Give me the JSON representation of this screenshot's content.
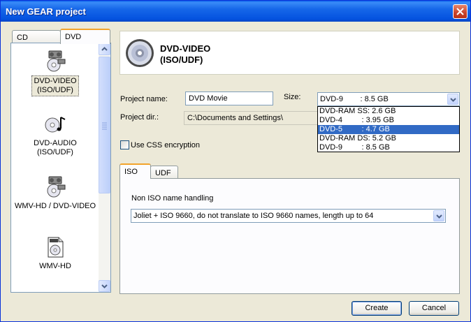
{
  "window": {
    "title": "New GEAR project"
  },
  "left_panel": {
    "tabs": [
      {
        "label": "CD"
      },
      {
        "label": "DVD"
      }
    ],
    "active_tab": "DVD",
    "items": [
      {
        "label": "DVD-VIDEO\n(ISO/UDF)",
        "icon": "dvd-video-icon",
        "selected": true
      },
      {
        "label": "DVD-AUDIO\n(ISO/UDF)",
        "icon": "dvd-audio-icon",
        "selected": false
      },
      {
        "label": "WMV-HD / DVD-VIDEO",
        "icon": "wmv-hd-dvd-video-icon",
        "selected": false
      },
      {
        "label": "WMV-HD",
        "icon": "wmv-hd-icon",
        "selected": false
      }
    ]
  },
  "header": {
    "title": "DVD-VIDEO\n(ISO/UDF)",
    "icon": "disc-icon"
  },
  "form": {
    "project_name_label": "Project name:",
    "project_name_value": "DVD Movie",
    "size_label": "Size:",
    "size_value": "DVD-9        : 8.5 GB",
    "size_options": [
      "DVD-RAM SS: 2.6 GB",
      "DVD-4         : 3.95 GB",
      "DVD-5         : 4.7 GB",
      "DVD-RAM DS: 5.2 GB",
      "DVD-9         : 8.5 GB"
    ],
    "size_highlighted_index": 2,
    "project_dir_label": "Project dir.:",
    "project_dir_value": "C:\\Documents and Settings\\",
    "css_label": "Use CSS encryption",
    "css_checked": false
  },
  "fs_tabs": [
    {
      "label": "ISO"
    },
    {
      "label": "UDF"
    }
  ],
  "fs_active_tab": "ISO",
  "iso": {
    "name_handling_label": "Non ISO name handling",
    "name_handling_value": "Joliet + ISO 9660, do not translate to ISO 9660 names, length up to 64"
  },
  "buttons": {
    "create": "Create",
    "cancel": "Cancel"
  },
  "colors": {
    "titlebar": "#0A5EEA",
    "selection": "#316AC5",
    "tab_accent": "#F2A32B",
    "face": "#ECE9D8"
  }
}
